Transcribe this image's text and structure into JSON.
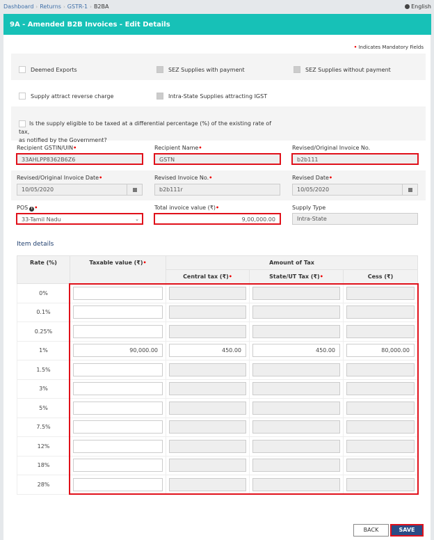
{
  "breadcrumb": [
    {
      "label": "Dashboard",
      "link": true
    },
    {
      "label": "Returns",
      "link": true
    },
    {
      "label": "GSTR-1",
      "link": true
    },
    {
      "label": "B2BA",
      "link": false
    }
  ],
  "language": {
    "icon": "globe-icon",
    "label": "English"
  },
  "header": {
    "title": "9A - Amended B2B Invoices - Edit Details"
  },
  "mandatory_note": "Indicates Mandatory Fields",
  "required_mark": "•",
  "checkboxes": {
    "deemed_exports": {
      "label": "Deemed Exports",
      "checked": false,
      "disabled": false
    },
    "sez_with_payment": {
      "label": "SEZ Supplies with payment",
      "checked": false,
      "disabled": true
    },
    "sez_without_payment": {
      "label": "SEZ Supplies without payment",
      "checked": false,
      "disabled": true
    },
    "reverse_charge": {
      "label": "Supply attract reverse charge",
      "checked": false,
      "disabled": false
    },
    "intra_state_igst": {
      "label": "Intra-State Supplies attracting IGST",
      "checked": false,
      "disabled": true
    },
    "differential_pct": {
      "label_line1": "Is the supply eligible to be taxed at a differential percentage (%) of the existing rate of tax,",
      "label_line2": "as notified by the Government?",
      "checked": false
    }
  },
  "fields": {
    "recipient_gstin": {
      "label": "Recipient GSTIN/UIN",
      "value": "33AHLPP8362B6Z6"
    },
    "recipient_name": {
      "label": "Recipient Name",
      "value": "GSTN"
    },
    "orig_invoice_no": {
      "label": "Revised/Original Invoice No.",
      "value": "b2b111"
    },
    "orig_invoice_date": {
      "label": "Revised/Original Invoice Date",
      "value": "10/05/2020"
    },
    "revised_invoice_no": {
      "label": "Revised Invoice No.",
      "value": "b2b111r"
    },
    "revised_date": {
      "label": "Revised Date",
      "value": "10/05/2020"
    },
    "pos": {
      "label": "POS",
      "value": "33-Tamil Nadu"
    },
    "total_invoice_value": {
      "label": "Total invoice value (₹)",
      "value": "9,00,000.00"
    },
    "supply_type": {
      "label": "Supply Type",
      "value": "Intra-State"
    }
  },
  "item_details": {
    "title": "Item details",
    "headers": {
      "rate": "Rate (%)",
      "taxable": "Taxable value (₹)",
      "amount_of_tax": "Amount of Tax",
      "central": "Central tax (₹)",
      "state": "State/UT Tax (₹)",
      "cess": "Cess (₹)"
    },
    "rows": [
      {
        "rate": "0%",
        "taxable": "",
        "central": "",
        "state": "",
        "cess": "",
        "enabled": false
      },
      {
        "rate": "0.1%",
        "taxable": "",
        "central": "",
        "state": "",
        "cess": "",
        "enabled": false
      },
      {
        "rate": "0.25%",
        "taxable": "",
        "central": "",
        "state": "",
        "cess": "",
        "enabled": false
      },
      {
        "rate": "1%",
        "taxable": "90,000.00",
        "central": "450.00",
        "state": "450.00",
        "cess": "80,000.00",
        "enabled": true
      },
      {
        "rate": "1.5%",
        "taxable": "",
        "central": "",
        "state": "",
        "cess": "",
        "enabled": false
      },
      {
        "rate": "3%",
        "taxable": "",
        "central": "",
        "state": "",
        "cess": "",
        "enabled": false
      },
      {
        "rate": "5%",
        "taxable": "",
        "central": "",
        "state": "",
        "cess": "",
        "enabled": false
      },
      {
        "rate": "7.5%",
        "taxable": "",
        "central": "",
        "state": "",
        "cess": "",
        "enabled": false
      },
      {
        "rate": "12%",
        "taxable": "",
        "central": "",
        "state": "",
        "cess": "",
        "enabled": false
      },
      {
        "rate": "18%",
        "taxable": "",
        "central": "",
        "state": "",
        "cess": "",
        "enabled": false
      },
      {
        "rate": "28%",
        "taxable": "",
        "central": "",
        "state": "",
        "cess": "",
        "enabled": false
      }
    ]
  },
  "buttons": {
    "back": "BACK",
    "save": "SAVE"
  },
  "colors": {
    "header_bg": "#17c1b7",
    "save_bg": "#2b4c86",
    "highlight": "#e0101a"
  }
}
